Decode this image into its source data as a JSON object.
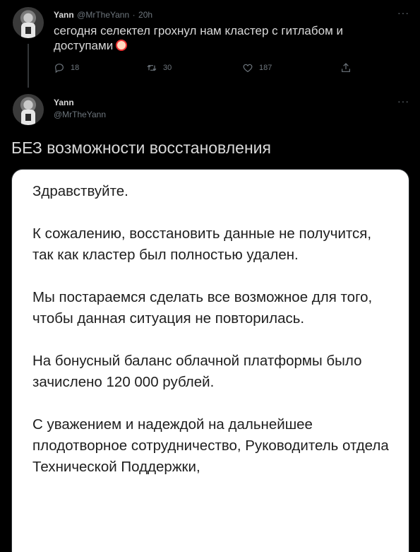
{
  "tweet1": {
    "author_name": "Yann",
    "author_handle": "@MrTheYann",
    "separator": "·",
    "time": "20h",
    "more": "···",
    "text": "сегодня селектел грохнул нам кластер с гитлабом и доступами",
    "emoji_icon": "clown-face-icon",
    "actions": {
      "reply_count": "18",
      "retweet_count": "30",
      "like_count": "187"
    }
  },
  "tweet2": {
    "author_name": "Yann",
    "author_handle": "@MrTheYann",
    "more": "···",
    "text": "БЕЗ возможности восстановления"
  },
  "card": {
    "paragraphs": [
      "Здравствуйте.",
      "К сожалению, восстановить данные не получится, так как кластер был полностью удален.",
      "Мы постараемся сделать все возможное для того, чтобы данная ситуация не повторилась.",
      "На бонусный баланс облачной платформы было зачислено 120 000 рублей.",
      "С уважением и надеждой на дальнейшее плодотворное сотрудничество, Руководитель отдела Технической Поддержки,"
    ]
  },
  "colors": {
    "background": "#000000",
    "text": "#d9d9d9",
    "muted": "#6e767d",
    "card_bg": "#ffffff",
    "card_text": "#1e1e1e"
  }
}
